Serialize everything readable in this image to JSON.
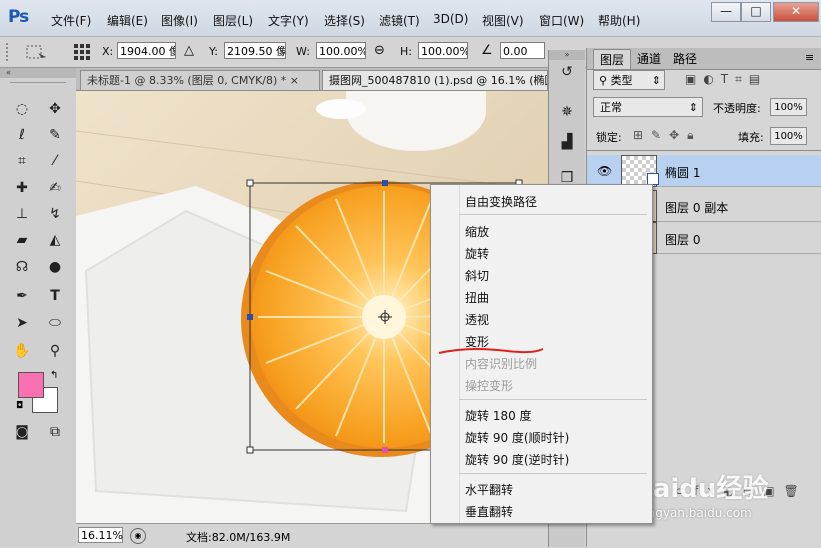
{
  "app": {
    "logo": "Ps"
  },
  "menu": [
    "文件(F)",
    "编辑(E)",
    "图像(I)",
    "图层(L)",
    "文字(Y)",
    "选择(S)",
    "滤镜(T)",
    "3D(D)",
    "视图(V)",
    "窗口(W)",
    "帮助(H)"
  ],
  "window_controls": {
    "minimize": "—",
    "maximize": "□",
    "close": "✕"
  },
  "options": {
    "x_label": "X:",
    "x_value": "1904.00 像",
    "y_label": "Y:",
    "y_value": "2109.50 像",
    "w_label": "W:",
    "w_value": "100.00%",
    "h_label": "H:",
    "h_value": "100.00%",
    "angle_value": "0.00"
  },
  "tabs": [
    {
      "label": "未标题-1 @ 8.33% (图层 0, CMYK/8) * ×",
      "active": true
    },
    {
      "label": "摄图网_500487810 (1).psd @ 16.1% (椭圆",
      "active": false
    }
  ],
  "status": {
    "zoom": "16.11%",
    "doc": "文档:82.0M/163.9M"
  },
  "panel": {
    "tabs": [
      "图层",
      "通道",
      "路径"
    ],
    "filter_label": "类型",
    "blend_mode": "正常",
    "opacity_label": "不透明度:",
    "opacity_value": "100%",
    "lock_label": "锁定:",
    "fill_label": "填充:",
    "fill_value": "100%",
    "layers": [
      {
        "name": "椭圆 1",
        "selected": true
      },
      {
        "name": "图层 0 副本",
        "selected": false
      },
      {
        "name": "图层 0",
        "selected": false
      }
    ]
  },
  "context_menu": {
    "groups": [
      [
        {
          "label": "自由变换路径",
          "enabled": true
        }
      ],
      [
        {
          "label": "缩放",
          "enabled": true
        },
        {
          "label": "旋转",
          "enabled": true
        },
        {
          "label": "斜切",
          "enabled": true
        },
        {
          "label": "扭曲",
          "enabled": true
        },
        {
          "label": "透视",
          "enabled": true
        },
        {
          "label": "变形",
          "enabled": true
        },
        {
          "label": "内容识别比例",
          "enabled": false
        },
        {
          "label": "操控变形",
          "enabled": false
        }
      ],
      [
        {
          "label": "旋转 180 度",
          "enabled": true
        },
        {
          "label": "旋转 90 度(顺时针)",
          "enabled": true
        },
        {
          "label": "旋转 90 度(逆时针)",
          "enabled": true
        }
      ],
      [
        {
          "label": "水平翻转",
          "enabled": true
        },
        {
          "label": "垂直翻转",
          "enabled": true
        }
      ]
    ]
  },
  "watermark": {
    "brand": "Baidu经验",
    "url": "jingyan.baidu.com"
  },
  "colors": {
    "foreground": "#f86fb2",
    "background": "#ffffff",
    "selected_layer": "#b9d1f0",
    "annotation": "#e0201b"
  }
}
